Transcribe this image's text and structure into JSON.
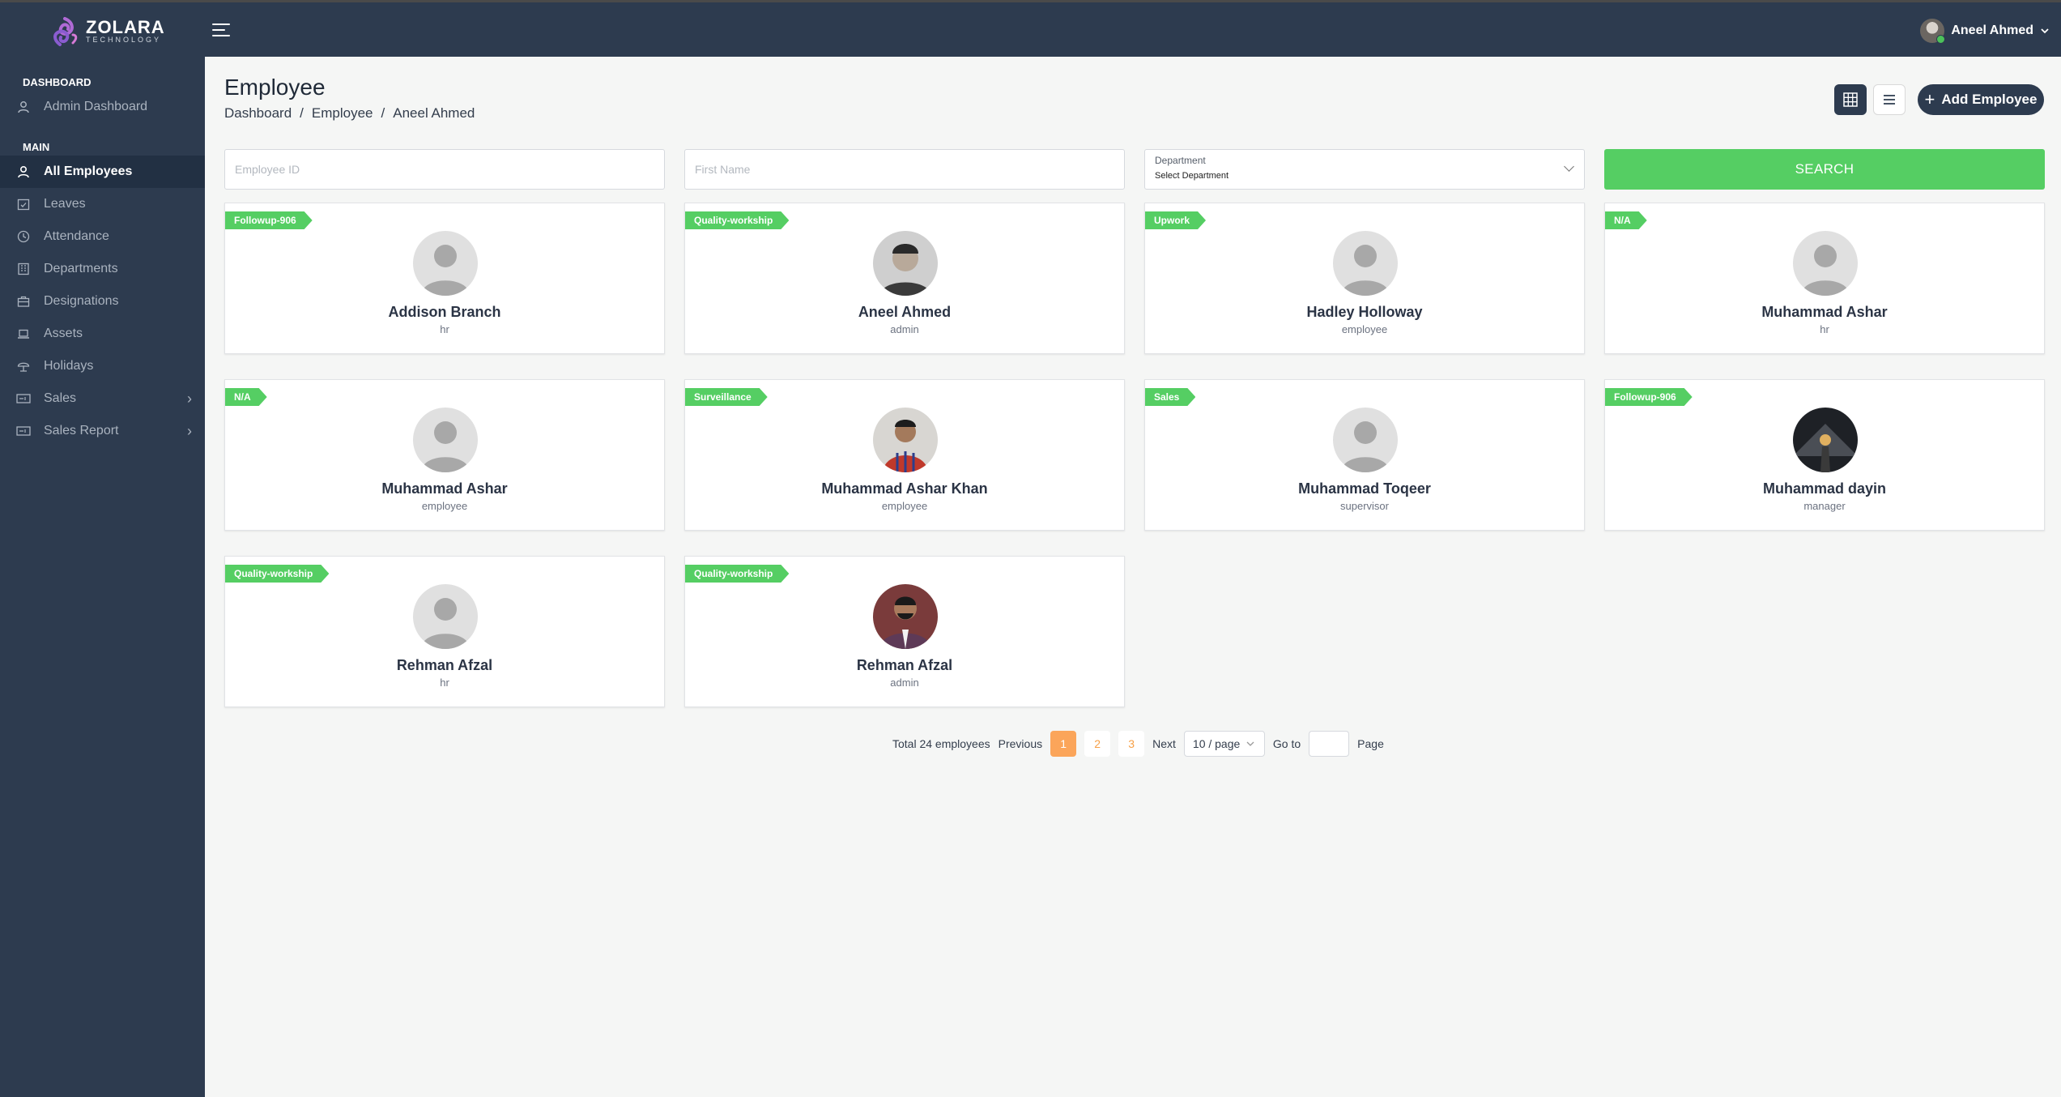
{
  "brand": {
    "name": "ZOLARA",
    "tagline": "TECHNOLOGY"
  },
  "user": {
    "name": "Aneel Ahmed"
  },
  "sidebar": {
    "dashboard_heading": "DASHBOARD",
    "main_heading": "MAIN",
    "items": [
      {
        "label": "Admin Dashboard",
        "icon": "user-icon"
      },
      {
        "label": "All Employees",
        "icon": "user-icon",
        "active": true
      },
      {
        "label": "Leaves",
        "icon": "calendar-check-icon"
      },
      {
        "label": "Attendance",
        "icon": "clock-icon"
      },
      {
        "label": "Departments",
        "icon": "building-icon"
      },
      {
        "label": "Designations",
        "icon": "briefcase-icon"
      },
      {
        "label": "Assets",
        "icon": "laptop-icon"
      },
      {
        "label": "Holidays",
        "icon": "umbrella-icon"
      },
      {
        "label": "Sales",
        "icon": "ticket-icon",
        "has_submenu": true
      },
      {
        "label": "Sales Report",
        "icon": "ticket-icon",
        "has_submenu": true
      }
    ]
  },
  "page": {
    "title": "Employee",
    "breadcrumb": [
      "Dashboard",
      "Employee",
      "Aneel Ahmed"
    ],
    "add_button": "Add Employee"
  },
  "filters": {
    "employee_id_placeholder": "Employee ID",
    "first_name_placeholder": "First Name",
    "department_label": "Department",
    "department_value": "Select Department",
    "search_button": "SEARCH"
  },
  "employees": [
    {
      "tag": "Followup-906",
      "name": "Addison Branch",
      "role": "hr",
      "photo": "placeholder"
    },
    {
      "tag": "Quality-workship",
      "name": "Aneel Ahmed",
      "role": "admin",
      "photo": "photo"
    },
    {
      "tag": "Upwork",
      "name": "Hadley Holloway",
      "role": "employee",
      "photo": "placeholder"
    },
    {
      "tag": "N/A",
      "name": "Muhammad Ashar",
      "role": "hr",
      "photo": "placeholder"
    },
    {
      "tag": "N/A",
      "name": "Muhammad Ashar",
      "role": "employee",
      "photo": "placeholder"
    },
    {
      "tag": "Surveillance",
      "name": "Muhammad Ashar Khan",
      "role": "employee",
      "photo": "photo"
    },
    {
      "tag": "Sales",
      "name": "Muhammad Toqeer",
      "role": "supervisor",
      "photo": "placeholder"
    },
    {
      "tag": "Followup-906",
      "name": "Muhammad dayin",
      "role": "manager",
      "photo": "photo"
    },
    {
      "tag": "Quality-workship",
      "name": "Rehman Afzal",
      "role": "hr",
      "photo": "placeholder"
    },
    {
      "tag": "Quality-workship",
      "name": "Rehman Afzal",
      "role": "admin",
      "photo": "photo"
    }
  ],
  "pagination": {
    "total": "Total 24 employees",
    "previous": "Previous",
    "pages": [
      "1",
      "2",
      "3"
    ],
    "current": "1",
    "next": "Next",
    "page_size": "10 / page",
    "goto_label": "Go to",
    "page_label": "Page"
  },
  "colors": {
    "topbar": "#2d3b4f",
    "sidebar": "#2d3b4f",
    "ribbon": "#55ce63",
    "search": "#55ce63",
    "pager_active": "#fba55a"
  }
}
